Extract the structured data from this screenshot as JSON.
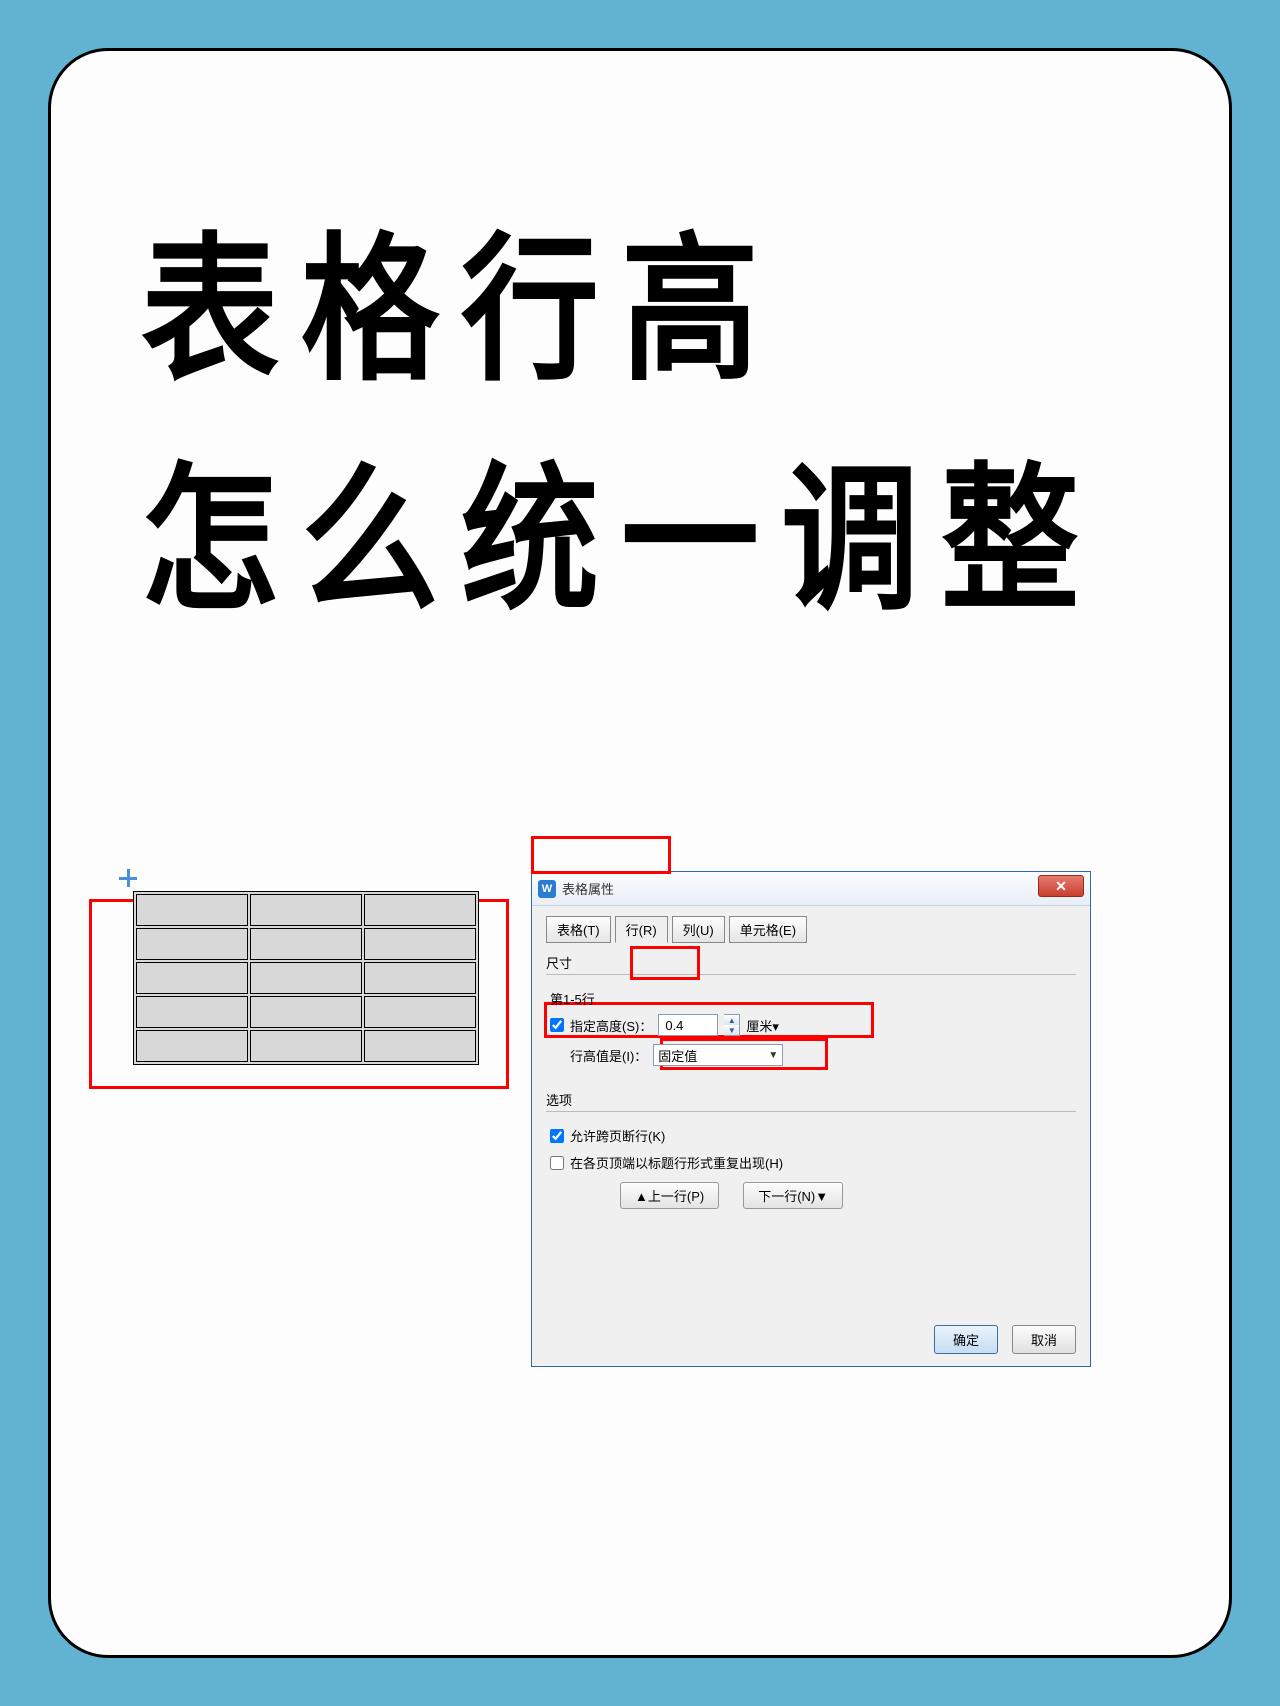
{
  "heading": {
    "line1": "表格行高",
    "line2": "怎么统一调整"
  },
  "dialog": {
    "title": "表格属性",
    "icon_letter": "W",
    "tabs": {
      "table": "表格(T)",
      "row": "行(R)",
      "column": "列(U)",
      "cell": "单元格(E)"
    },
    "size": {
      "section_label": "尺寸",
      "rows_range": "第1-5行",
      "specify_height_label": "指定高度(S)：",
      "height_value": "0.4",
      "unit": "厘米▾",
      "row_height_is_label": "行高值是(I)：",
      "row_height_is_value": "固定值"
    },
    "options": {
      "section_label": "选项",
      "allow_break": "允许跨页断行(K)",
      "repeat_header": "在各页顶端以标题行形式重复出现(H)"
    },
    "nav": {
      "prev": "▲上一行(P)",
      "next": "下一行(N)▼"
    },
    "footer": {
      "ok": "确定",
      "cancel": "取消"
    }
  }
}
